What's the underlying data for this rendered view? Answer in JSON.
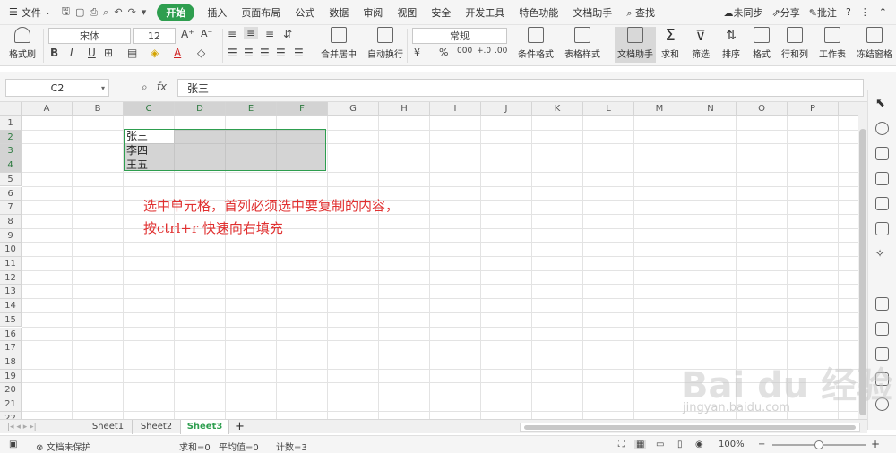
{
  "menubar": {
    "file": "文件",
    "tabs": [
      "开始",
      "插入",
      "页面布局",
      "公式",
      "数据",
      "审阅",
      "视图",
      "安全",
      "开发工具",
      "特色功能",
      "文档助手"
    ],
    "search": "查找",
    "sync": "未同步",
    "share": "分享",
    "comment": "批注"
  },
  "toolbar": {
    "format_painter": "格式刷",
    "font_name": "宋体",
    "font_size": "12",
    "merge_center": "合并居中",
    "wrap_text": "自动换行",
    "number_format": "常规",
    "cond_format": "条件格式",
    "table_style": "表格样式",
    "doc_helper": "文档助手",
    "sum": "求和",
    "filter": "筛选",
    "sort": "排序",
    "format": "格式",
    "row_col": "行和列",
    "worksheet": "工作表",
    "freeze": "冻结窗格"
  },
  "formula_bar": {
    "name_box": "C2",
    "fx": "fx",
    "value": "张三"
  },
  "grid": {
    "columns": [
      "A",
      "B",
      "C",
      "D",
      "E",
      "F",
      "G",
      "H",
      "I",
      "J",
      "K",
      "L",
      "M",
      "N",
      "O",
      "P"
    ],
    "rows": [
      "1",
      "2",
      "3",
      "4",
      "5",
      "6",
      "7",
      "8",
      "9",
      "10",
      "11",
      "12",
      "13",
      "14",
      "15",
      "16",
      "17",
      "18",
      "19",
      "20",
      "21",
      "22"
    ],
    "cells": {
      "C2": "张三",
      "C3": "李四",
      "C4": "王五"
    }
  },
  "annotation": {
    "line1": "选中单元格，首列必须选中要复制的内容，",
    "line2": "按ctrl+r 快速向右填充"
  },
  "sheets": {
    "tabs": [
      "Sheet1",
      "Sheet2",
      "Sheet3"
    ],
    "active": "Sheet3",
    "add": "+"
  },
  "status": {
    "protect": "文档未保护",
    "sum": "求和=0",
    "avg": "平均值=0",
    "count": "计数=3",
    "zoom": "100%"
  },
  "watermark": {
    "logo": "Bai du 经验",
    "url": "jingyan.baidu.com"
  },
  "colors": {
    "accent": "#2e9e4f",
    "note": "#e03030"
  }
}
